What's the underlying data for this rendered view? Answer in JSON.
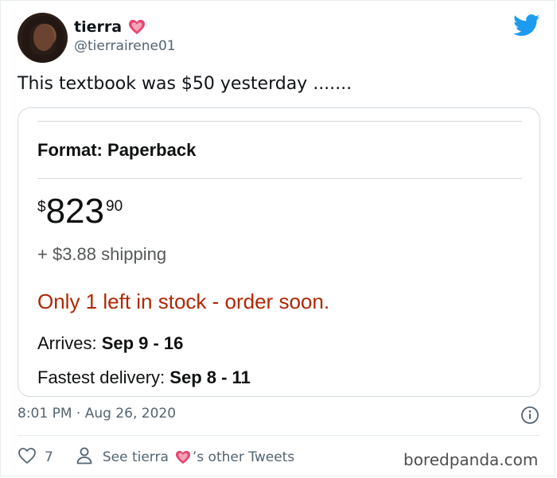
{
  "tweet": {
    "display_name": "tierra",
    "handle": "@tierrairene01",
    "text": "This textbook was $50 yesterday .......",
    "timestamp": "8:01 PM · Aug 26, 2020",
    "like_count": "7",
    "other_tweets_prefix": "See tierra",
    "other_tweets_suffix": "’s other Tweets"
  },
  "icons": {
    "name_badge": "pink-heart-icon",
    "logo": "twitter-bird-icon",
    "info": "info-circle-icon",
    "like": "heart-outline-icon",
    "profile": "person-icon"
  },
  "product": {
    "format_label": "Format:",
    "format_value": "Paperback",
    "price_symbol": "$",
    "price_whole": "823",
    "price_fraction": "90",
    "shipping": "+ $3.88 shipping",
    "stock": "Only 1 left in stock - order soon.",
    "arrives_label": "Arrives:",
    "arrives_dates": "Sep 9 - 16",
    "fastest_label": "Fastest delivery:",
    "fastest_dates": "Sep 8 - 11"
  },
  "watermark": "boredpanda.com",
  "colors": {
    "twitter_blue": "#1d9bf0",
    "heart_pink": "#e8466f",
    "amazon_stock_red": "#b12704",
    "muted_text": "#536471"
  }
}
